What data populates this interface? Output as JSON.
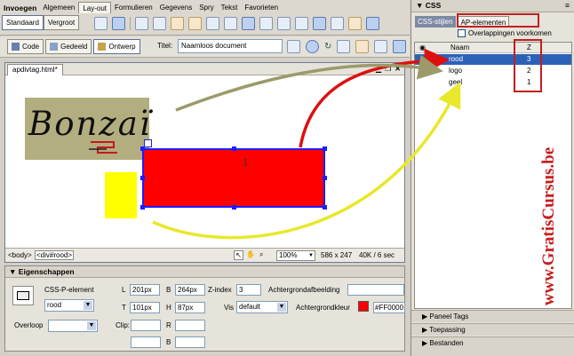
{
  "insert_panel": {
    "title": "Invoegen",
    "tabs": [
      "Algemeen",
      "Lay-out",
      "Formulieren",
      "Gegevens",
      "Spry",
      "Tekst",
      "Favorieten"
    ],
    "active_tab": "Lay-out",
    "standard_button": "Standaard",
    "expanded_button": "Vergroot"
  },
  "document_toolbar": {
    "code_button": "Code",
    "split_button": "Gedeeld",
    "design_button": "Ontwerp",
    "title_label": "Titel:",
    "title_value": "Naamloos document"
  },
  "document": {
    "tab_title": "apdivtag.html*",
    "logo_text": "Bonzaï",
    "cursor_glyph": "I"
  },
  "status_bar": {
    "tag_body": "<body>",
    "tag_div": "<div#rood>",
    "zoom": "100%",
    "dimensions": "586 x 247",
    "download": "40K / 6 sec"
  },
  "properties": {
    "title": "Eigenschappen",
    "element_type": "CSS-P-element",
    "element_id": "rood",
    "L_label": "L",
    "L_value": "201px",
    "T_label": "T",
    "T_value": "101px",
    "W_label": "B",
    "W_value": "264px",
    "H_label": "H",
    "H_value": "87px",
    "zindex_label": "Z-index",
    "zindex_value": "3",
    "vis_label": "Vis",
    "vis_value": "default",
    "bg_image_label": "Achtergrondafbeelding",
    "bg_color_label": "Achtergrondkleur",
    "bg_color_value": "#FF0000",
    "overflow_label": "Overloop",
    "clip_label": "Clip:",
    "clip_L": "L",
    "clip_R": "R",
    "clip_T": "T",
    "clip_B": "B"
  },
  "right_panel": {
    "title": "CSS",
    "tab_css": "CSS-stijlen",
    "tab_ap": "AP-elementen",
    "prevent_overlaps": "Overlappingen voorkomen",
    "col_name": "Naam",
    "col_z": "Z",
    "rows": [
      {
        "name": "rood",
        "z": "3",
        "selected": true
      },
      {
        "name": "logo",
        "z": "2",
        "selected": false
      },
      {
        "name": "geel",
        "z": "1",
        "selected": false
      }
    ],
    "bottom_panels": [
      "Paneel Tags",
      "Toepassing",
      "Bestanden"
    ]
  },
  "watermark": "www.GratisCursus.be",
  "colors": {
    "accent_red": "#ff0000",
    "selection_blue": "#1d1dff",
    "yellow": "#ffff00",
    "logo_bg": "#b2ae7f",
    "arrow_olive": "#9c9a6a"
  }
}
